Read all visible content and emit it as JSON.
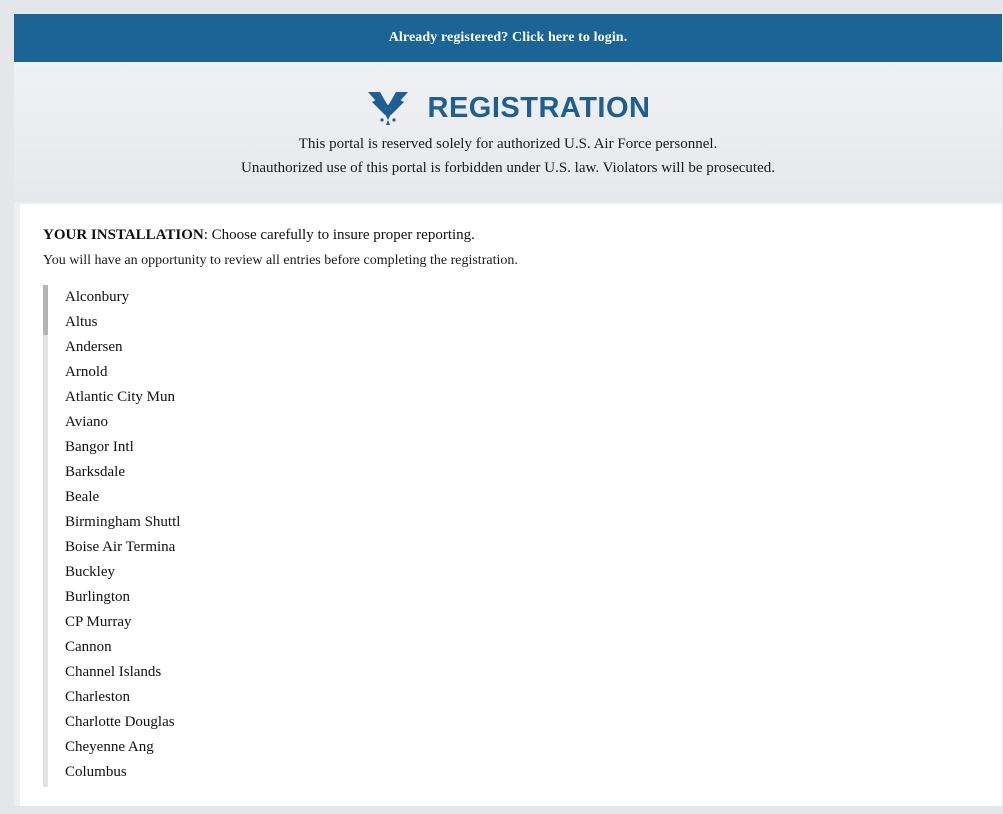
{
  "top_bar": {
    "login_link": "Already registered? Click here to login."
  },
  "header": {
    "title": "REGISTRATION",
    "notice_line1": "This portal is reserved solely for authorized U.S. Air Force personnel.",
    "notice_line2": "Unauthorized use of this portal is forbidden under U.S. law.  Violators will be prosecuted."
  },
  "installation": {
    "heading_bold": "YOUR INSTALLATION",
    "heading_rest": ": Choose carefully to insure proper reporting.",
    "subtext": "You will have an opportunity to review all entries before completing the registration.",
    "options": [
      "Alconbury",
      "Altus",
      "Andersen",
      "Arnold",
      "Atlantic City Mun",
      "Aviano",
      "Bangor Intl",
      "Barksdale",
      "Beale",
      "Birmingham Shuttl",
      "Boise Air Termina",
      "Buckley",
      "Burlington",
      "CP Murray",
      "Cannon",
      "Channel Islands",
      "Charleston",
      "Charlotte Douglas",
      "Cheyenne Ang",
      "Columbus"
    ]
  },
  "colors": {
    "bar": "#1a6496",
    "title": "#1d5e94"
  },
  "icons": {
    "logo": "air-force-wings-logo"
  }
}
